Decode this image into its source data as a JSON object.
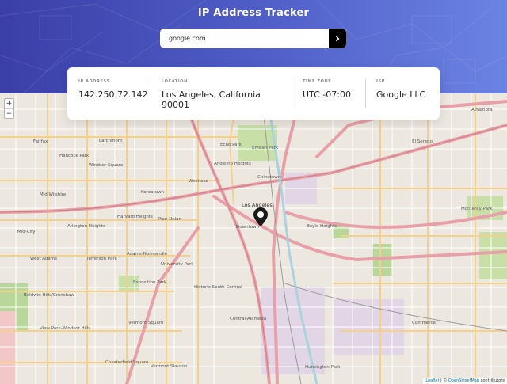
{
  "header": {
    "title": "IP Address Tracker",
    "search_value": "google.com",
    "search_button_icon": "chevron-right-icon"
  },
  "info": {
    "ip": {
      "label": "IP ADDRESS",
      "value": "142.250.72.142"
    },
    "location": {
      "label": "LOCATION",
      "value": "Los Angeles, California 90001"
    },
    "timezone": {
      "label": "TIME ZONE",
      "value": "UTC -07:00"
    },
    "isp": {
      "label": "ISP",
      "value": "Google LLC"
    }
  },
  "map": {
    "zoom_in": "+",
    "zoom_out": "−",
    "attribution_leaflet": "Leaflet",
    "attribution_osm": "OpenStreetMap",
    "attribution_suffix": "contributors",
    "attribution_sep": " | © ",
    "labels": [
      "Fairfax",
      "Hancock Park",
      "Windsor Square",
      "Larchmont",
      "Mid-Wilshire",
      "Koreatown",
      "Harvard Heights",
      "Pico-Union",
      "Arlington Heights",
      "Mid-City",
      "West Adams",
      "Jefferson Park",
      "Adams-Normandie",
      "University Park",
      "Exposition Park",
      "Historic South-Central",
      "Central-Alameda",
      "Vermont Square",
      "Vermont Slauson",
      "Chesterfield Square",
      "View Park-Windsor Hills",
      "Baldwin Hills/Crenshaw",
      "Downtown",
      "Chinatown",
      "Echo Park",
      "Elysian Park",
      "Angelino Heights",
      "Westlake",
      "Boyle Heights",
      "Monterey Park",
      "El Sereno",
      "Alhambra",
      "Huntington Park",
      "Commerce",
      "Los Angeles"
    ],
    "colors": {
      "road_major": "#e8a0a8",
      "road_minor": "#f5d08a",
      "park": "#c8e0a8",
      "water": "#aad3df"
    }
  }
}
